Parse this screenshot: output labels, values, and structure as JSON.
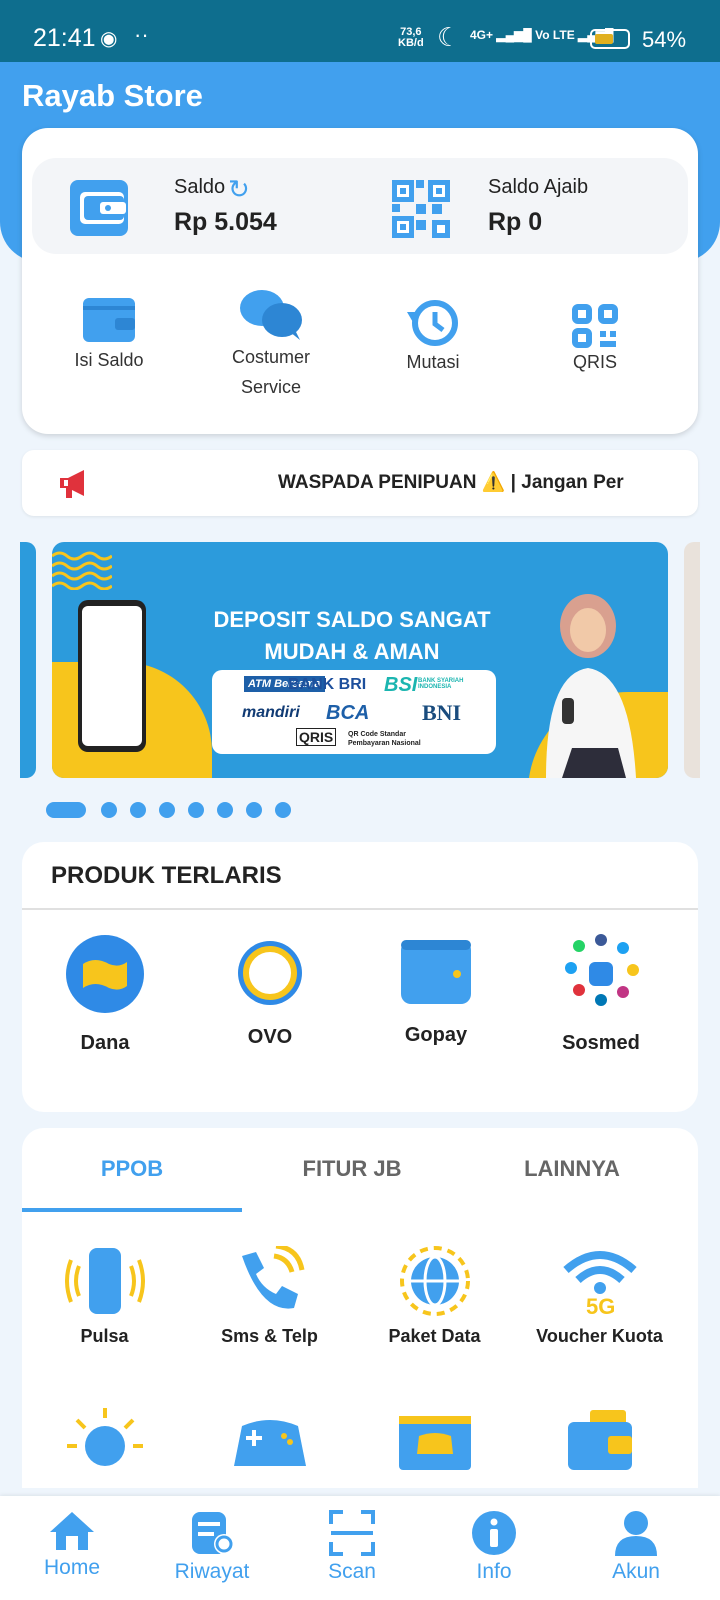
{
  "status_bar": {
    "time": "21:41",
    "net_speed_value": "73,6",
    "net_speed_unit": "KB/d",
    "network": "4G+",
    "volte": "Vo LTE",
    "battery": "54%"
  },
  "app": {
    "title": "Rayab Store"
  },
  "balance": {
    "saldo_label": "Saldo",
    "saldo_value": "Rp 5.054",
    "ajaib_label": "Saldo Ajaib",
    "ajaib_value": "Rp 0"
  },
  "quick_actions": [
    {
      "label": "Isi Saldo",
      "icon": "wallet-icon"
    },
    {
      "label": "Costumer Service",
      "icon": "chat-bubbles-icon"
    },
    {
      "label": "Mutasi",
      "icon": "history-icon"
    },
    {
      "label": "QRIS",
      "icon": "qr-icon"
    }
  ],
  "announcement": {
    "text": "WASPADA PENIPUAN ⚠️ | Jangan Per",
    "icon": "megaphone-icon"
  },
  "banner": {
    "headline": "DEPOSIT SALDO SANGAT MUDAH & AMAN",
    "logos": [
      "ATM Bersama",
      "BANK BRI",
      "BSI",
      "BANK SYARIAH INDONESIA",
      "mandiri",
      "BCA",
      "BNI",
      "QRIS",
      "QR Code Standar Pembayaran Nasional"
    ],
    "slide_count": 8,
    "active_slide": 1
  },
  "popular": {
    "title": "PRODUK TERLARIS",
    "items": [
      {
        "label": "Dana",
        "icon": "dana-icon"
      },
      {
        "label": "OVO",
        "icon": "ovo-icon"
      },
      {
        "label": "Gopay",
        "icon": "gopay-wallet-icon"
      },
      {
        "label": "Sosmed",
        "icon": "social-media-icon"
      }
    ]
  },
  "tabs": [
    {
      "label": "PPOB",
      "active": true
    },
    {
      "label": "FITUR JB",
      "active": false
    },
    {
      "label": "LAINNYA",
      "active": false
    }
  ],
  "services": [
    {
      "label": "Pulsa",
      "icon": "phone-vibrate-icon"
    },
    {
      "label": "Sms & Telp",
      "icon": "phone-call-icon"
    },
    {
      "label": "Paket Data",
      "icon": "globe-icon"
    },
    {
      "label": "Voucher Kuota",
      "icon": "wifi-5g-icon"
    },
    {
      "label": "",
      "icon": "lightbulb-icon"
    },
    {
      "label": "",
      "icon": "gamepad-icon"
    },
    {
      "label": "",
      "icon": "game-ticket-icon"
    },
    {
      "label": "",
      "icon": "wallet-card-icon"
    }
  ],
  "bottom_nav": [
    {
      "label": "Home",
      "icon": "home-icon"
    },
    {
      "label": "Riwayat",
      "icon": "history-doc-icon"
    },
    {
      "label": "Scan",
      "icon": "scan-icon"
    },
    {
      "label": "Info",
      "icon": "info-icon"
    },
    {
      "label": "Akun",
      "icon": "account-icon"
    }
  ],
  "colors": {
    "primary": "#41a0ee",
    "status_bar": "#0e6e8e",
    "accent_yellow": "#f7c51c",
    "alert_red": "#e0323c"
  }
}
